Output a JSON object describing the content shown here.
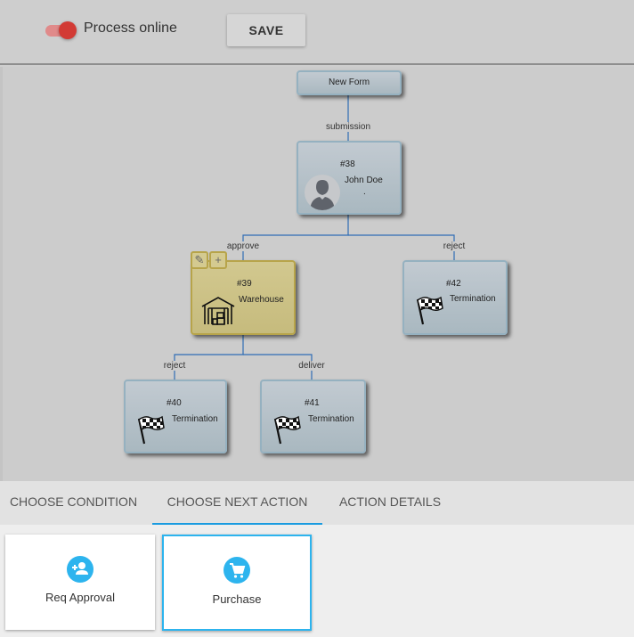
{
  "toolbar": {
    "toggle_label": "Process online",
    "toggle_on": true,
    "save_label": "SAVE"
  },
  "flow": {
    "start": {
      "label": "New Form"
    },
    "edges": {
      "submission": "submission",
      "approve": "approve",
      "reject_top": "reject",
      "reject_bottom": "reject",
      "deliver": "deliver"
    },
    "nodes": [
      {
        "id": "#38",
        "label": "John Doe",
        "sub": ".",
        "icon": "user-avatar-icon"
      },
      {
        "id": "#39",
        "label": "Warehouse",
        "icon": "warehouse-icon",
        "selected": true
      },
      {
        "id": "#42",
        "label": "Termination",
        "icon": "checkered-flag-icon"
      },
      {
        "id": "#40",
        "label": "Termination",
        "icon": "checkered-flag-icon"
      },
      {
        "id": "#41",
        "label": "Termination",
        "icon": "checkered-flag-icon"
      }
    ],
    "node_tools": {
      "edit": "✎",
      "add": "+"
    }
  },
  "tabs": [
    {
      "label": "CHOOSE CONDITION",
      "active": false
    },
    {
      "label": "CHOOSE NEXT ACTION",
      "active": true
    },
    {
      "label": "ACTION DETAILS",
      "active": false
    }
  ],
  "actions": [
    {
      "label": "Req Approval",
      "icon": "person-add-icon",
      "active": false
    },
    {
      "label": "Purchase",
      "icon": "shopping-cart-icon",
      "active": true
    }
  ],
  "colors": {
    "accent": "#2db4ee",
    "tab_indicator": "#1a9be0",
    "toggle": "#d23b35",
    "edge": "#2f6db5",
    "selected_node": "#c6bb7d"
  }
}
